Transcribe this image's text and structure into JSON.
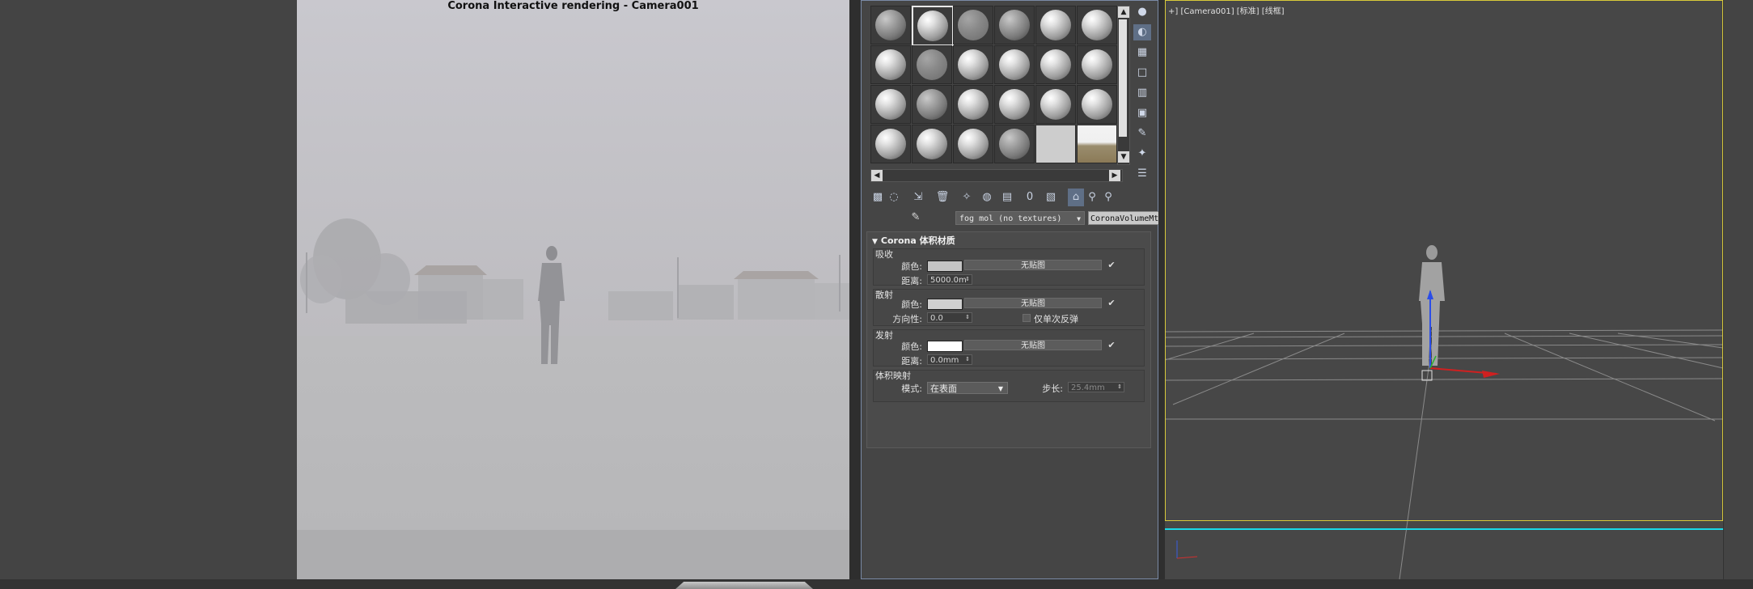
{
  "render_window": {
    "title": "Corona Interactive rendering - Camera001"
  },
  "material_editor": {
    "slots": [
      {
        "style": "rough"
      },
      {
        "style": "selected"
      },
      {
        "style": "grey"
      },
      {
        "style": "rough"
      },
      {
        "style": "ball"
      },
      {
        "style": "ball"
      },
      {
        "style": "ball"
      },
      {
        "style": "grey"
      },
      {
        "style": "ball"
      },
      {
        "style": "ball"
      },
      {
        "style": "ball"
      },
      {
        "style": "ball"
      },
      {
        "style": "ball"
      },
      {
        "style": "rough"
      },
      {
        "style": "ball"
      },
      {
        "style": "ball"
      },
      {
        "style": "ball"
      },
      {
        "style": "ball"
      },
      {
        "style": "ball"
      },
      {
        "style": "ball"
      },
      {
        "style": "ball"
      },
      {
        "style": "rough"
      },
      {
        "style": "flat"
      },
      {
        "style": "landscape"
      }
    ],
    "material_name": "fog mol (no textures)",
    "material_type": "CoronaVolumeMtl",
    "rollout_title": "Corona 体积材质",
    "absorption": {
      "group_title": "吸收",
      "color_label": "颜色:",
      "color_value": "#c4c4c4",
      "map_label": "无贴图",
      "distance_label": "距离:",
      "distance_value": "5000.0m",
      "map_checked": "✔"
    },
    "scattering": {
      "group_title": "散射",
      "color_label": "颜色:",
      "color_value": "#d0d0d0",
      "map_label": "无贴图",
      "map_checked": "✔",
      "directionality_label": "方向性:",
      "directionality_value": "0.0",
      "single_bounce_label": "仅单次反弹"
    },
    "emission": {
      "group_title": "发射",
      "color_label": "颜色:",
      "color_value": "#ffffff",
      "map_label": "无贴图",
      "map_checked": "✔",
      "distance_label": "距离:",
      "distance_value": "0.0mm"
    },
    "volumetric_displacement": {
      "group_title": "体积映射",
      "mode_label": "模式:",
      "mode_value": "在表面",
      "step_label": "步长:",
      "step_value": "25.4mm"
    },
    "side_tool_icons": [
      "sample-sphere-icon",
      "backlight-icon",
      "background-icon",
      "sample-uv-icon",
      "video-color-check-icon",
      "make-preview-icon",
      "options-icon",
      "select-by-material-icon",
      "material-navigator-icon"
    ],
    "bottom_tool_icons": [
      "get-material-icon",
      "put-to-scene-icon",
      "assign-to-selection-icon",
      "reset-map-icon",
      "make-unique-icon",
      "put-to-library-icon",
      "material-id-channel-icon",
      "show-in-viewport-icon",
      "show-end-result-icon",
      "go-to-parent-icon",
      "go-forward-icon"
    ]
  },
  "viewport": {
    "label": "+] [Camera001] [标准] [线框]"
  }
}
